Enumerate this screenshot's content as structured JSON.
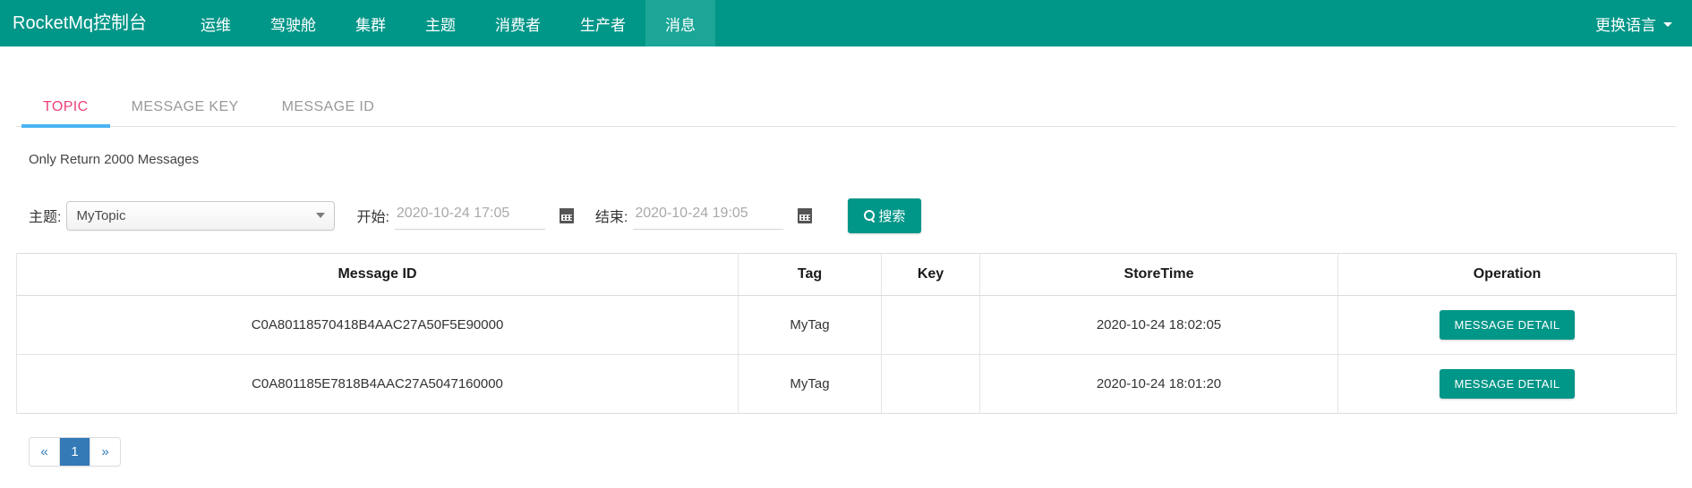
{
  "navbar": {
    "brand": "RocketMq控制台",
    "items": [
      {
        "label": "运维",
        "active": false
      },
      {
        "label": "驾驶舱",
        "active": false
      },
      {
        "label": "集群",
        "active": false
      },
      {
        "label": "主题",
        "active": false
      },
      {
        "label": "消费者",
        "active": false
      },
      {
        "label": "生产者",
        "active": false
      },
      {
        "label": "消息",
        "active": true
      }
    ],
    "language_toggle": "更换语言",
    "bg_color": "#009688",
    "active_item_color": "#1ba697"
  },
  "tabs": [
    {
      "label": "TOPIC",
      "active": true
    },
    {
      "label": "MESSAGE KEY",
      "active": false
    },
    {
      "label": "MESSAGE ID",
      "active": false
    }
  ],
  "tab_colors": {
    "active_text": "#ec407a",
    "active_underline": "#4bb4f2",
    "inactive_text": "#999999"
  },
  "notice": "Only Return 2000 Messages",
  "search_form": {
    "topic_label": "主题:",
    "topic_value": "MyTopic",
    "begin_label": "开始:",
    "begin_value": "2020-10-24 17:05",
    "begin_placeholder": "2020-10-24 17:05",
    "end_label": "结束:",
    "end_value": "2020-10-24 19:05",
    "end_placeholder": "2020-10-24 19:05",
    "search_button": "搜索"
  },
  "table": {
    "headers": [
      "Message ID",
      "Tag",
      "Key",
      "StoreTime",
      "Operation"
    ],
    "rows": [
      {
        "message_id": "C0A80118570418B4AAC27A50F5E90000",
        "tag": "MyTag",
        "key": "",
        "store_time": "2020-10-24 18:02:05",
        "operation": "MESSAGE DETAIL"
      },
      {
        "message_id": "C0A801185E7818B4AAC27A5047160000",
        "tag": "MyTag",
        "key": "",
        "store_time": "2020-10-24 18:01:20",
        "operation": "MESSAGE DETAIL"
      }
    ]
  },
  "pagination": {
    "prev": "«",
    "next": "»",
    "pages": [
      "1"
    ],
    "current": "1",
    "active_color": "#337ab7"
  }
}
